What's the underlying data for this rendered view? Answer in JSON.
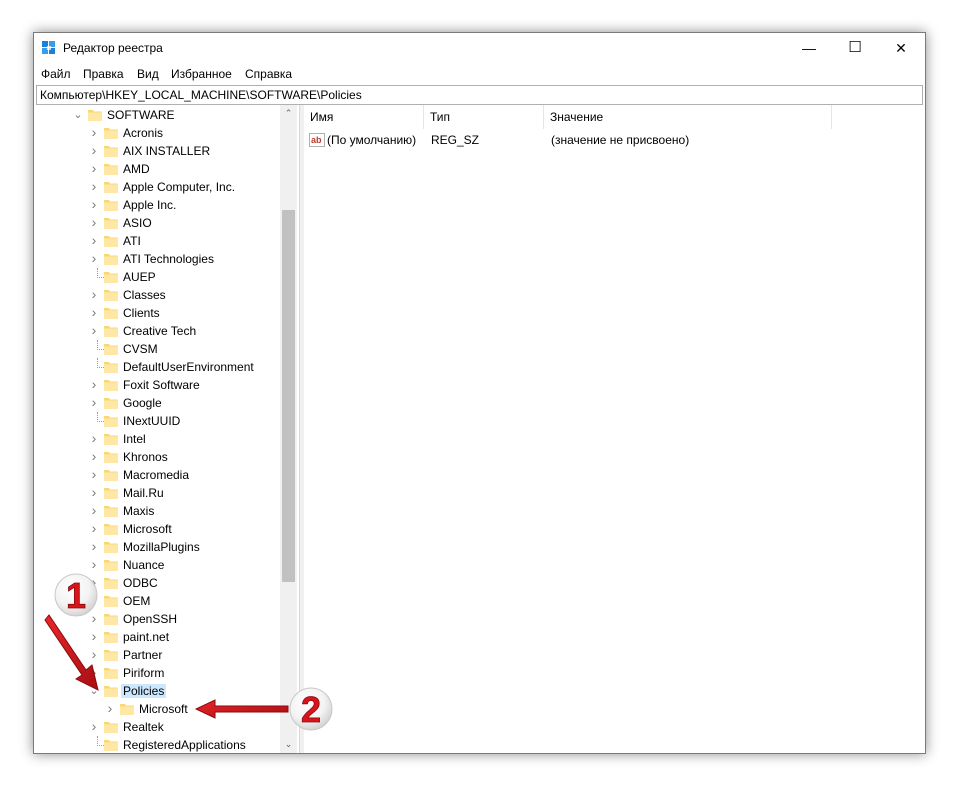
{
  "window": {
    "title": "Редактор реестра",
    "minimize": "—",
    "maximize": "☐",
    "close": "✕"
  },
  "menu": [
    "Файл",
    "Правка",
    "Вид",
    "Избранное",
    "Справка"
  ],
  "address": "Компьютер\\HKEY_LOCAL_MACHINE\\SOFTWARE\\Policies",
  "tree": {
    "root": "SOFTWARE",
    "items": [
      {
        "label": "Acronis",
        "expander": "closed"
      },
      {
        "label": "AIX INSTALLER",
        "expander": "closed"
      },
      {
        "label": "AMD",
        "expander": "closed"
      },
      {
        "label": "Apple Computer, Inc.",
        "expander": "closed"
      },
      {
        "label": "Apple Inc.",
        "expander": "closed"
      },
      {
        "label": "ASIO",
        "expander": "closed"
      },
      {
        "label": "ATI",
        "expander": "closed"
      },
      {
        "label": "ATI Technologies",
        "expander": "closed"
      },
      {
        "label": "AUEP",
        "expander": "none"
      },
      {
        "label": "Classes",
        "expander": "closed"
      },
      {
        "label": "Clients",
        "expander": "closed"
      },
      {
        "label": "Creative Tech",
        "expander": "closed"
      },
      {
        "label": "CVSM",
        "expander": "none"
      },
      {
        "label": "DefaultUserEnvironment",
        "expander": "none"
      },
      {
        "label": "Foxit Software",
        "expander": "closed"
      },
      {
        "label": "Google",
        "expander": "closed"
      },
      {
        "label": "INextUUID",
        "expander": "none"
      },
      {
        "label": "Intel",
        "expander": "closed"
      },
      {
        "label": "Khronos",
        "expander": "closed"
      },
      {
        "label": "Macromedia",
        "expander": "closed"
      },
      {
        "label": "Mail.Ru",
        "expander": "closed"
      },
      {
        "label": "Maxis",
        "expander": "closed"
      },
      {
        "label": "Microsoft",
        "expander": "closed"
      },
      {
        "label": "MozillaPlugins",
        "expander": "closed"
      },
      {
        "label": "Nuance",
        "expander": "closed"
      },
      {
        "label": "ODBC",
        "expander": "closed"
      },
      {
        "label": "OEM",
        "expander": "closed"
      },
      {
        "label": "OpenSSH",
        "expander": "closed"
      },
      {
        "label": "paint.net",
        "expander": "closed"
      },
      {
        "label": "Partner",
        "expander": "closed"
      },
      {
        "label": "Piriform",
        "expander": "closed"
      },
      {
        "label": "Policies",
        "expander": "open",
        "selected": true
      },
      {
        "label": "Microsoft",
        "expander": "closed",
        "child": true
      },
      {
        "label": "Realtek",
        "expander": "closed"
      },
      {
        "label": "RegisteredApplications",
        "expander": "none"
      }
    ]
  },
  "list": {
    "columns": [
      "Имя",
      "Тип",
      "Значение"
    ],
    "rows": [
      {
        "name": "(По умолчанию)",
        "type": "REG_SZ",
        "value": "(значение не присвоено)",
        "icon": "string-value-icon"
      }
    ]
  },
  "annotations": {
    "step1": "1",
    "step2": "2",
    "color": "#d9151b"
  }
}
